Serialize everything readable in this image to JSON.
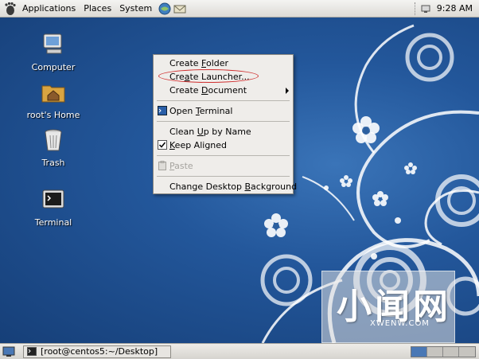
{
  "top_panel": {
    "menus": [
      "Applications",
      "Places",
      "System"
    ],
    "clock": "9:28 AM"
  },
  "desktop_icons": [
    {
      "label": "Computer",
      "icon": "computer-icon"
    },
    {
      "label": "root's Home",
      "icon": "home-folder-icon"
    },
    {
      "label": "Trash",
      "icon": "trash-icon"
    },
    {
      "label": "Terminal",
      "icon": "terminal-icon"
    }
  ],
  "context_menu": {
    "items": [
      {
        "label": "Create Folder",
        "mnemonic": "F"
      },
      {
        "label": "Create Launcher...",
        "mnemonic": "a"
      },
      {
        "label": "Create Document",
        "mnemonic": "D",
        "submenu": true
      },
      {
        "label": "Open Terminal",
        "mnemonic": "T",
        "icon": "terminal-icon"
      },
      {
        "label": "Clean Up by Name",
        "mnemonic": "U"
      },
      {
        "label": "Keep Aligned",
        "mnemonic": "K",
        "checked": true
      },
      {
        "label": "Paste",
        "mnemonic": "P",
        "disabled": true,
        "icon": "paste-icon"
      },
      {
        "label": "Change Desktop Background",
        "mnemonic": "B"
      }
    ]
  },
  "watermark": {
    "brand": "小闻网",
    "domain": "XWENW.COM"
  },
  "bottom_panel": {
    "task_label": "[root@centos5:~/Desktop]",
    "workspaces": 4,
    "active_workspace": 1
  },
  "colors": {
    "desktop_bg": "#23579b",
    "panel_bg": "#e2e0db",
    "menu_bg": "#efedea",
    "highlight_ellipse": "#d03030"
  }
}
